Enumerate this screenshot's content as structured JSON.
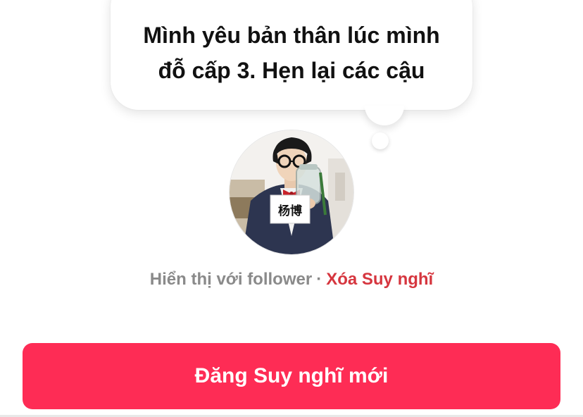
{
  "thought": {
    "line1": "Mình yêu bản thân lúc mình",
    "line2": "đỗ cấp 3. Hẹn lại các cậu"
  },
  "avatar": {
    "icon": "profile-photo",
    "badge_text": "杨博"
  },
  "visibility": {
    "label": "Hiển thị với follower",
    "separator": "·",
    "delete_label": "Xóa Suy nghĩ"
  },
  "actions": {
    "post_new_label": "Đăng Suy nghĩ mới"
  },
  "colors": {
    "accent": "#fe2c55",
    "delete": "#d6363f",
    "muted": "#8a8a8a"
  }
}
